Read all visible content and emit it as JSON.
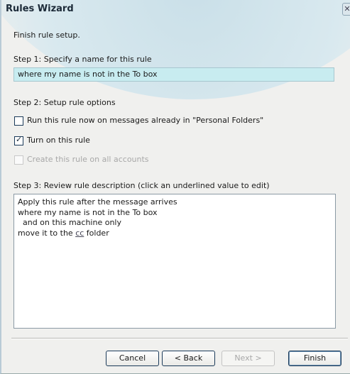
{
  "window": {
    "title": "Rules Wizard",
    "close_glyph": "✕"
  },
  "intro": "Finish rule setup.",
  "step1": {
    "label": "Step 1: Specify a name for this rule",
    "rule_name": "where my name is not in the To box"
  },
  "step2": {
    "label": "Step 2: Setup rule options",
    "options": [
      {
        "label": "Run this rule now on messages already in \"Personal Folders\"",
        "checked": false,
        "enabled": true
      },
      {
        "label": "Turn on this rule",
        "checked": true,
        "enabled": true
      },
      {
        "label": "Create this rule on all accounts",
        "checked": false,
        "enabled": false
      }
    ]
  },
  "step3": {
    "label": "Step 3: Review rule description (click an underlined value to edit)",
    "lines": [
      "Apply this rule after the message arrives",
      "where my name is not in the To box",
      "  and on this machine only"
    ],
    "last_line_prefix": "move it to the ",
    "last_line_link": "cc",
    "last_line_suffix": " folder"
  },
  "buttons": {
    "cancel": "Cancel",
    "back": "< Back",
    "next": "Next >",
    "finish": "Finish"
  }
}
